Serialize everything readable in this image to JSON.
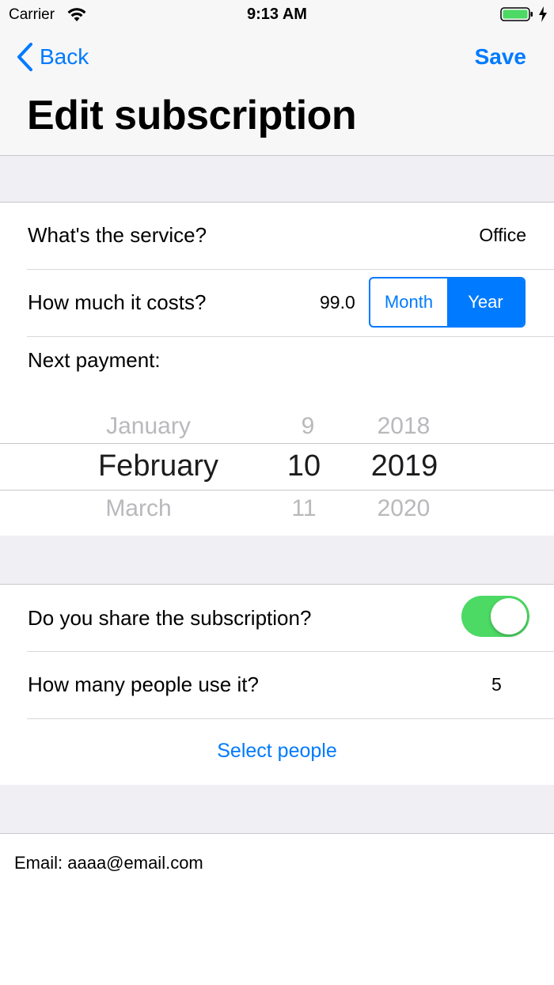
{
  "status_bar": {
    "carrier": "Carrier",
    "time": "9:13 AM",
    "icons": [
      "wifi-icon",
      "battery-icon",
      "charging-bolt-icon"
    ],
    "battery_color": "#4cd964"
  },
  "nav": {
    "back_label": "Back",
    "save_label": "Save",
    "title": "Edit subscription",
    "accent_color": "#007aff"
  },
  "service": {
    "label": "What's the service?",
    "value": "Office"
  },
  "cost": {
    "label": "How much it costs?",
    "value": "99.0",
    "period_options": [
      "Month",
      "Year"
    ],
    "selected_period": "Year"
  },
  "next_payment": {
    "label": "Next payment:",
    "picker": {
      "month": {
        "prev": "January",
        "selected": "February",
        "next": "March"
      },
      "day": {
        "prev": "9",
        "selected": "10",
        "next": "11"
      },
      "year": {
        "prev": "2018",
        "selected": "2019",
        "next": "2020"
      }
    }
  },
  "sharing": {
    "label": "Do you share the subscription?",
    "enabled": true,
    "toggle_color": "#4cd964",
    "people_label": "How many people use it?",
    "people_count": "5",
    "select_people_label": "Select people"
  },
  "footer": {
    "email_text": "Email: aaaa@email.com"
  }
}
